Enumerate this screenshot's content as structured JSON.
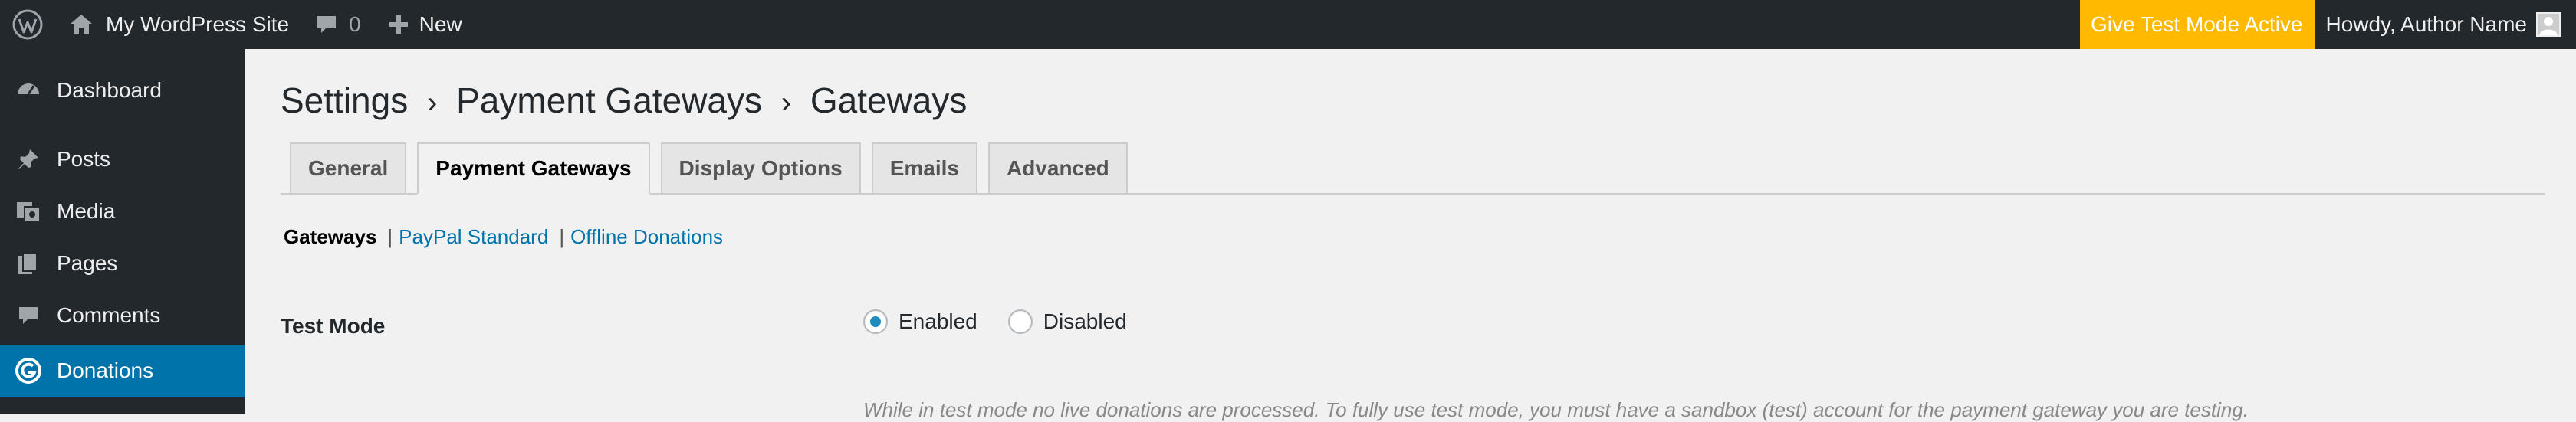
{
  "adminbar": {
    "wp_logo_icon": "wordpress-logo-icon",
    "site_name": "My WordPress Site",
    "comments_count": "0",
    "new_label": "New",
    "test_mode_badge": "Give Test Mode Active",
    "howdy": "Howdy, Author Name"
  },
  "menu": {
    "items": [
      {
        "label": "Dashboard",
        "icon": "dashboard-icon"
      },
      {
        "label": "Posts",
        "icon": "pin-icon"
      },
      {
        "label": "Media",
        "icon": "media-icon"
      },
      {
        "label": "Pages",
        "icon": "pages-icon"
      },
      {
        "label": "Comments",
        "icon": "comment-icon"
      },
      {
        "label": "Donations",
        "icon": "give-icon"
      }
    ],
    "current": "Donations"
  },
  "page": {
    "breadcrumb": [
      "Settings",
      "Payment Gateways",
      "Gateways"
    ],
    "separator": "›",
    "tabs": [
      {
        "label": "General"
      },
      {
        "label": "Payment Gateways"
      },
      {
        "label": "Display Options"
      },
      {
        "label": "Emails"
      },
      {
        "label": "Advanced"
      }
    ],
    "active_tab": "Payment Gateways",
    "subnav": {
      "current": "Gateways",
      "links": [
        "PayPal Standard",
        "Offline Donations"
      ],
      "separator": "|"
    },
    "test_mode": {
      "label": "Test Mode",
      "options": [
        "Enabled",
        "Disabled"
      ],
      "selected": "Enabled",
      "help": "While in test mode no live donations are processed. To fully use test mode, you must have a sandbox (test) account for the payment gateway you are testing."
    }
  },
  "colors": {
    "adminbar_bg": "#23282d",
    "menu_current_bg": "#0073aa",
    "test_mode_bg": "#ffba00",
    "link": "#0073aa"
  }
}
